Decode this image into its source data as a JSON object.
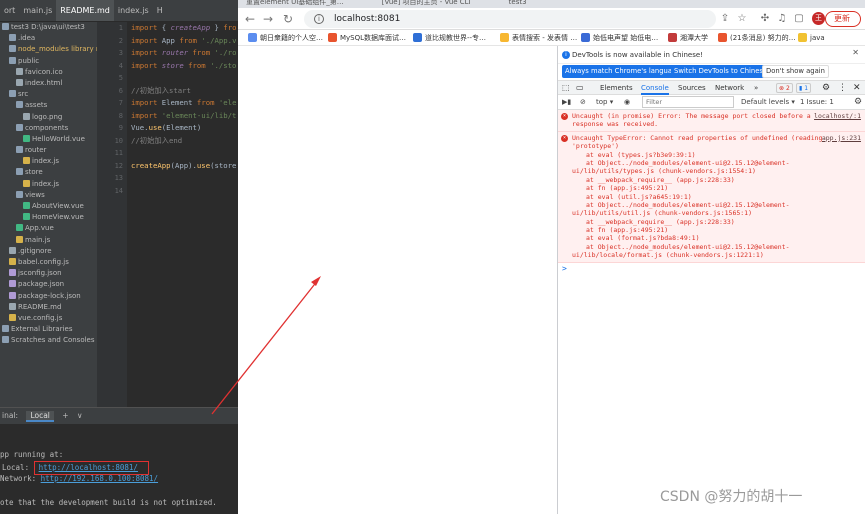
{
  "ide": {
    "tabs": [
      "ort",
      "main.js",
      "README.md",
      "index.js",
      "H"
    ],
    "tree": [
      {
        "label": "test3  D:\\java\\ui\\test3",
        "icon": "folder-icon",
        "indent": 0,
        "style": "root"
      },
      {
        "label": ".idea",
        "icon": "folder-icon",
        "indent": 1
      },
      {
        "label": "node_modules  library root",
        "icon": "folder-icon",
        "indent": 1,
        "style": "hl"
      },
      {
        "label": "public",
        "icon": "folder-icon",
        "indent": 1
      },
      {
        "label": "favicon.ico",
        "icon": "file-icon",
        "indent": 2
      },
      {
        "label": "index.html",
        "icon": "file-icon",
        "indent": 2
      },
      {
        "label": "src",
        "icon": "folder-icon",
        "indent": 1
      },
      {
        "label": "assets",
        "icon": "folder-icon",
        "indent": 2
      },
      {
        "label": "logo.png",
        "icon": "file-icon",
        "indent": 3
      },
      {
        "label": "components",
        "icon": "folder-icon",
        "indent": 2
      },
      {
        "label": "HelloWorld.vue",
        "icon": "vue-icon",
        "indent": 3
      },
      {
        "label": "router",
        "icon": "folder-icon",
        "indent": 2
      },
      {
        "label": "index.js",
        "icon": "js-icon",
        "indent": 3
      },
      {
        "label": "store",
        "icon": "folder-icon",
        "indent": 2
      },
      {
        "label": "index.js",
        "icon": "js-icon",
        "indent": 3
      },
      {
        "label": "views",
        "icon": "folder-icon",
        "indent": 2
      },
      {
        "label": "AboutView.vue",
        "icon": "vue-icon",
        "indent": 3
      },
      {
        "label": "HomeView.vue",
        "icon": "vue-icon",
        "indent": 3
      },
      {
        "label": "App.vue",
        "icon": "vue-icon",
        "indent": 2
      },
      {
        "label": "main.js",
        "icon": "js-icon",
        "indent": 2
      },
      {
        "label": ".gitignore",
        "icon": "file-icon",
        "indent": 1
      },
      {
        "label": "babel.config.js",
        "icon": "js-icon",
        "indent": 1
      },
      {
        "label": "jsconfig.json",
        "icon": "json-icon",
        "indent": 1
      },
      {
        "label": "package.json",
        "icon": "json-icon",
        "indent": 1
      },
      {
        "label": "package-lock.json",
        "icon": "json-icon",
        "indent": 1
      },
      {
        "label": "README.md",
        "icon": "file-icon",
        "indent": 1
      },
      {
        "label": "vue.config.js",
        "icon": "js-icon",
        "indent": 1
      },
      {
        "label": "External Libraries",
        "icon": "folder-icon",
        "indent": 0
      },
      {
        "label": "Scratches and Consoles",
        "icon": "folder-icon",
        "indent": 0
      }
    ],
    "line_numbers": [
      "1",
      "2",
      "3",
      "4",
      "5",
      "6",
      "7",
      "8",
      "9",
      "10",
      "11",
      "12",
      "13",
      "14"
    ],
    "code": [
      [
        [
          "kw",
          "import "
        ],
        [
          "id",
          "{ "
        ],
        [
          "it",
          "createApp"
        ],
        [
          "id",
          " } "
        ],
        [
          "kw",
          "fro"
        ]
      ],
      [
        [
          "kw",
          "import "
        ],
        [
          "id",
          "App "
        ],
        [
          "kw",
          "from "
        ],
        [
          "str",
          "'./App.v"
        ]
      ],
      [
        [
          "kw",
          "import "
        ],
        [
          "it",
          "router "
        ],
        [
          "kw",
          "from "
        ],
        [
          "str",
          "'./ro"
        ]
      ],
      [
        [
          "kw",
          "import "
        ],
        [
          "it",
          "store "
        ],
        [
          "kw",
          "from "
        ],
        [
          "str",
          "'./sto"
        ]
      ],
      [],
      [
        [
          "cm",
          "//初始加入start"
        ]
      ],
      [
        [
          "kw",
          "import "
        ],
        [
          "id",
          "Element "
        ],
        [
          "kw",
          "from "
        ],
        [
          "str",
          "'ele"
        ]
      ],
      [
        [
          "kw",
          "import "
        ],
        [
          "str",
          "'element-ui/lib/t"
        ]
      ],
      [
        [
          "id",
          "Vue."
        ],
        [
          "fn",
          "use"
        ],
        [
          "id",
          "(Element)"
        ]
      ],
      [
        [
          "cm",
          "//初始加入end"
        ]
      ],
      [],
      [
        [
          "fn",
          "createApp"
        ],
        [
          "id",
          "(App)."
        ],
        [
          "fn",
          "use"
        ],
        [
          "id",
          "(store"
        ]
      ],
      [],
      []
    ],
    "terminal": {
      "label": "inal:",
      "tab": "Local",
      "add": "+",
      "more": "∨",
      "lines": {
        "running": "pp running at:",
        "local_label": "Local:  ",
        "local_url": "http://localhost:8081/",
        "network_label": "Network:  ",
        "network_url": "http://192.168.0.100:8081/",
        "note": "ote that the development build is not optimized."
      }
    }
  },
  "browser": {
    "tab_strip": [
      "重置element UI基础组件_第…",
      "[Vue] 项目的主页 - Vue CLI",
      "test3"
    ],
    "address": "localhost:8081",
    "profile_initial": "王",
    "update_label": "更新",
    "bookmarks": [
      {
        "label": "朝日衆籍的个人空…",
        "color": "#5b8def"
      },
      {
        "label": "MySQL数据库面试…",
        "color": "#e8542e"
      },
      {
        "label": "道比规教世界--专…",
        "color": "#2f6fd6"
      },
      {
        "label": "表情搜索 - 发表情 …",
        "color": "#f7b731"
      },
      {
        "label": "始低电声望 始低电…",
        "color": "#3a6ad6"
      },
      {
        "label": "湘潭大学",
        "color": "#c23b3b"
      },
      {
        "label": "(21条消息) 努力的…",
        "color": "#e8542e"
      },
      {
        "label": "java",
        "color": "#f1c232"
      }
    ]
  },
  "devtools": {
    "info_text": "DevTools is now available in Chinese!",
    "buttons": [
      "Always match Chrome's language",
      "Switch DevTools to Chinese",
      "Don't show again"
    ],
    "tabs": [
      "Elements",
      "Console",
      "Sources",
      "Network"
    ],
    "error_count": "2",
    "message_count": "1",
    "filter": {
      "context": "top",
      "placeholder": "Filter",
      "levels": "Default levels",
      "issues": "1 Issue: 1"
    },
    "errors": [
      {
        "source": "localhost/:1",
        "lines": [
          "Uncaught (in promise) Error: The message port closed before a",
          "response was received."
        ]
      },
      {
        "source": "app.js:231",
        "lines": [
          "Uncaught TypeError: Cannot read properties of undefined (reading",
          "'prototype')",
          "    at eval (types.js?b3e9:39:1)",
          "    at Object../node_modules/element-ui@2.15.12@element-",
          "ui/lib/utils/types.js (chunk-vendors.js:1554:1)",
          "    at __webpack_require__ (app.js:228:33)",
          "    at fn (app.js:495:21)",
          "    at eval (util.js?a645:19:1)",
          "    at Object../node_modules/element-ui@2.15.12@element-",
          "ui/lib/utils/util.js (chunk-vendors.js:1565:1)",
          "    at __webpack_require__ (app.js:228:33)",
          "    at fn (app.js:495:21)",
          "    at eval (format.js?bda8:49:1)",
          "    at Object../node_modules/element-ui@2.15.12@element-",
          "ui/lib/locale/format.js (chunk-vendors.js:1221:1)"
        ]
      }
    ],
    "prompt": ">"
  },
  "watermark": "CSDN @努力的胡十一",
  "colors": {
    "annotation_red": "#e03131"
  }
}
